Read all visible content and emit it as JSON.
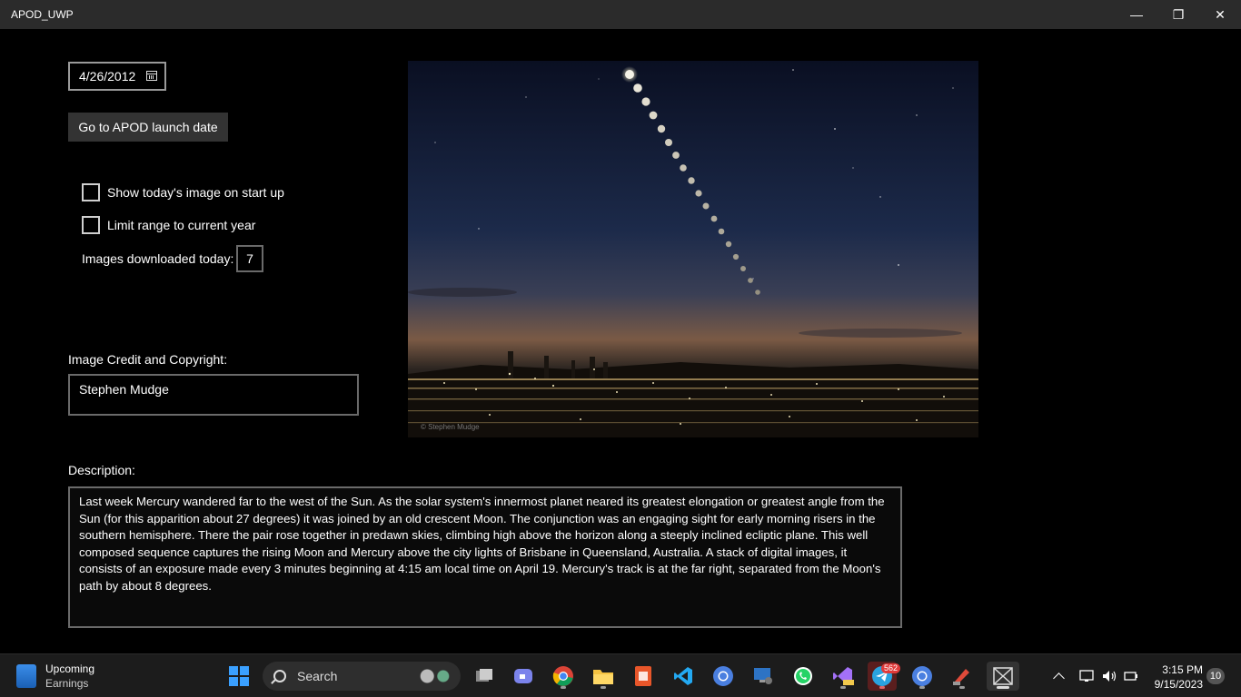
{
  "window": {
    "title": "APOD_UWP",
    "minimize_glyph": "—",
    "maximize_glyph": "❐",
    "close_glyph": "✕"
  },
  "controls": {
    "date_value": "4/26/2012",
    "launch_button_label": "Go to APOD launch date",
    "show_today_label": "Show today's image on start up",
    "show_today_checked": false,
    "limit_range_label": "Limit range to current year",
    "limit_range_checked": false,
    "downloaded_label": "Images downloaded today:",
    "downloaded_value": "7"
  },
  "credit": {
    "label": "Image Credit and Copyright:",
    "value": "Stephen Mudge"
  },
  "description": {
    "label": "Description:",
    "text": "Last week Mercury wandered far to the west of the Sun. As the solar system's innermost planet neared its greatest elongation or greatest angle from the Sun (for this apparition about 27 degrees) it was joined by an old crescent Moon. The conjunction was an engaging sight for early morning risers in the southern hemisphere. There the pair rose together in predawn skies, climbing high above the horizon along a steeply inclined ecliptic plane. This well composed sequence captures the rising Moon and Mercury above the city lights of Brisbane in Queensland, Australia. A stack of digital images, it consists of an exposure made every 3 minutes beginning at 4:15 am local time on April 19. Mercury's track is at the far right, separated from the Moon's path by about 8 degrees."
  },
  "image": {
    "watermark": "© Stephen Mudge"
  },
  "taskbar": {
    "widget_title": "Upcoming",
    "widget_subtitle": "Earnings",
    "search_label": "Search",
    "telegram_badge": "562",
    "time": "3:15 PM",
    "date": "9/15/2023",
    "notification_count": "10",
    "apps": [
      "start",
      "search",
      "widgets-copilot",
      "task-view",
      "teams",
      "chrome",
      "file-explorer",
      "office",
      "vscode",
      "chromium",
      "remote-desktop",
      "whatsapp",
      "visual-studio-preview",
      "telegram",
      "chromium-2",
      "ccleaner",
      "apod-uwp"
    ]
  },
  "colors": {
    "app_bg": "#000000",
    "titlebar_bg": "#2b2b2b",
    "button_bg": "#333333",
    "taskbar_bg": "#1c1c1c",
    "accent": "#0078d4"
  }
}
